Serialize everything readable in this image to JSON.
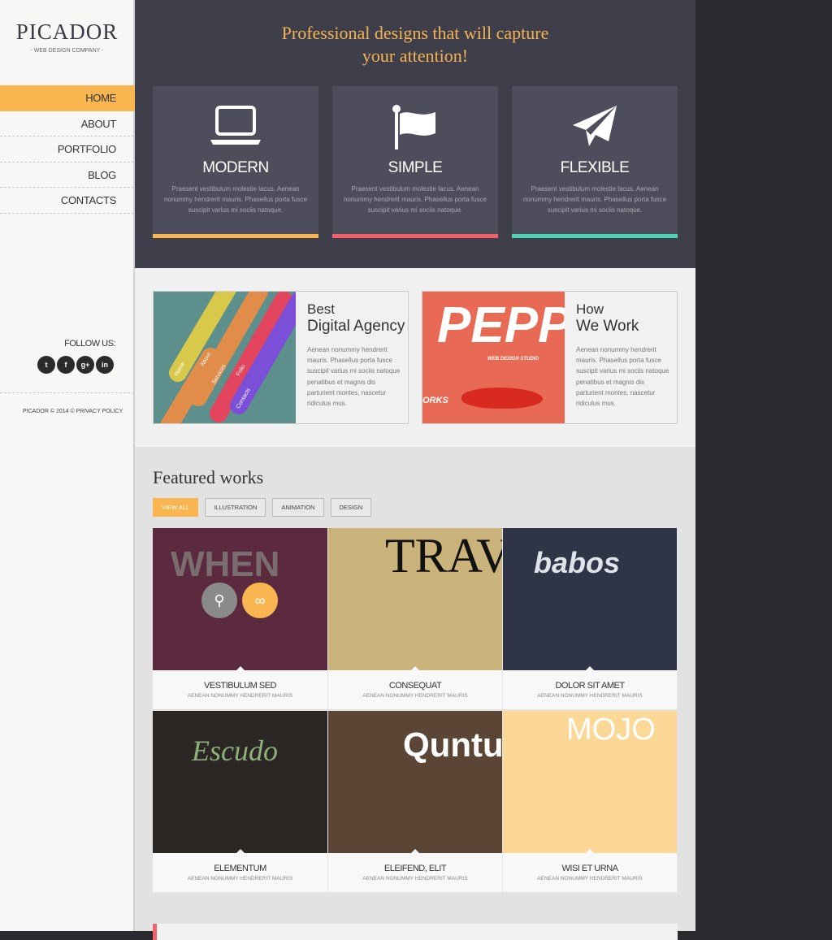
{
  "sidebar": {
    "logo": "PICADOR",
    "tagline": "- WEB DESIGN COMPANY -",
    "nav": [
      {
        "label": "HOME",
        "active": true
      },
      {
        "label": "ABOUT"
      },
      {
        "label": "PORTFOLIO"
      },
      {
        "label": "BLOG"
      },
      {
        "label": "CONTACTS"
      }
    ],
    "follow_label": "FOLLOW US:",
    "socials": [
      {
        "icon": "twitter-icon",
        "glyph": "t"
      },
      {
        "icon": "facebook-icon",
        "glyph": "f"
      },
      {
        "icon": "google-plus-icon",
        "glyph": "g+"
      },
      {
        "icon": "linkedin-icon",
        "glyph": "in"
      }
    ],
    "copyright": "PICADOR © 2014 © PRIVACY POLICY"
  },
  "hero": {
    "headline_1": "Professional designs that will capture",
    "headline_2": "your attention!",
    "features": [
      {
        "icon": "laptop-icon",
        "title": "MODERN",
        "text": "Praesent vestibulum molestie lacus. Aenean nonummy hendrerit mauris. Phasellus porta fusce suscipit varius mi sociis natoque.",
        "color": "#f9b54f"
      },
      {
        "icon": "flag-icon",
        "title": "SIMPLE",
        "text": "Praesent vestibulum molestie lacus. Aenean nonummy hendrerit mauris. Phasellus porta fusce suscipit varius mi sociis natoque.",
        "color": "#f2606a"
      },
      {
        "icon": "paper-plane-icon",
        "title": "FLEXIBLE",
        "text": "Praesent vestibulum molestie lacus. Aenean nonummy hendrerit mauris. Phasellus porta fusce suscipit varius mi sociis natoque.",
        "color": "#4ecfb8"
      }
    ]
  },
  "cards": [
    {
      "title_1": "Best",
      "title_2": "Digital Agency",
      "text": "Aenean nonummy hendrerit mauris. Phasellus porta fusce suscipit varius mi sociis natoque penatibus et magnis dis parturient montes, nascetur ridiculus mus.",
      "image_text": [
        "Home",
        "About",
        "Services",
        "Folio",
        "Contacts"
      ]
    },
    {
      "title_1": "How",
      "title_2": "We Work",
      "text": "Aenean nonummy hendrerit mauris. Phasellus porta fusce suscipit varius mi sociis natoque penatibus et magnis dis parturient montes, nascetur ridiculus mus.",
      "image_text": [
        "PEPPER",
        "WEB DESIGN STUDIO",
        "ORKS"
      ]
    }
  ],
  "featured": {
    "title": "Featured works",
    "filters": [
      {
        "label": "VIEW ALL",
        "active": true
      },
      {
        "label": "ILLUSTRATION"
      },
      {
        "label": "ANIMATION"
      },
      {
        "label": "DESIGN"
      }
    ],
    "works": [
      {
        "name": "VESTIBULUM SED",
        "sub": "AENEAN NONUMMY HENDRERIT MAURIS",
        "bg": "#5c2a3e",
        "art": "WHEN"
      },
      {
        "name": "CONSEQUAT",
        "sub": "AENEAN NONUMMY HENDRERIT MAURIS",
        "bg": "#c9b37a",
        "art": "TRAV"
      },
      {
        "name": "DOLOR SIT AMET",
        "sub": "AENEAN NONUMMY HENDRERIT MAURIS",
        "bg": "#2f3546",
        "art": "babos"
      },
      {
        "name": "ELEMENTUM",
        "sub": "AENEAN NONUMMY HENDRERIT MAURIS",
        "bg": "#2b2725",
        "art": "Escudo"
      },
      {
        "name": "ELEIFEND, ELIT",
        "sub": "AENEAN NONUMMY HENDRERIT MAURIS",
        "bg": "#5b4636",
        "art": "Quntu"
      },
      {
        "name": "WISI ET URNA",
        "sub": "AENEAN NONUMMY HENDRERIT MAURIS",
        "bg": "#fcd896",
        "art": "MOJO"
      }
    ]
  }
}
